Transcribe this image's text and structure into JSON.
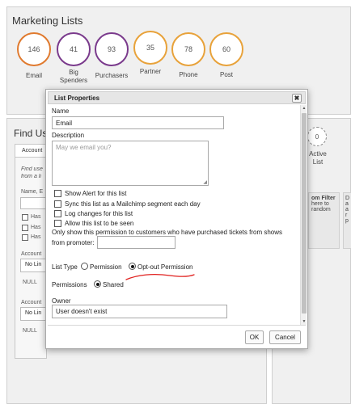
{
  "marketing": {
    "title": "Marketing Lists",
    "lists": [
      {
        "count": "146",
        "label": "Email",
        "color": "#e07a2e"
      },
      {
        "count": "41",
        "label": "Big Spenders",
        "color": "#7a3a8c"
      },
      {
        "count": "93",
        "label": "Purchasers",
        "color": "#7a3a8c"
      },
      {
        "count": "35",
        "label": "Partner",
        "color": "#e8a23a"
      },
      {
        "count": "78",
        "label": "Phone",
        "color": "#e8a23a"
      },
      {
        "count": "60",
        "label": "Post",
        "color": "#e8a23a"
      }
    ]
  },
  "find_users": {
    "title": "Find Us",
    "tab": "Account",
    "hint_line1": "Find use",
    "hint_line2": "from a li",
    "name_label": "Name, E",
    "has_rows": [
      "Has",
      "Has",
      "Has"
    ],
    "account_label_1": "Account",
    "no_limit_1": "No Lin",
    "null_1": "NULL",
    "account_label_2": "Account",
    "no_limit_2": "No Lin",
    "null_2": "NULL"
  },
  "right_panel": {
    "active_count": "0",
    "active_label": "Active List",
    "card_title": "om Filter",
    "card_line1": "here to",
    "card_line2": "random",
    "card2_line1": "D",
    "card2_line2": "a",
    "card2_line3": "a",
    "card2_line4": "r",
    "card2_line5": "p"
  },
  "dialog": {
    "title": "List Properties",
    "close_glyph": "✖",
    "name_label": "Name",
    "name_value": "Email",
    "description_label": "Description",
    "description_placeholder": "May we email you?",
    "checkboxes": [
      {
        "label": "Show Alert for this list",
        "checked": false
      },
      {
        "label": "Sync this list as a Mailchimp segment each day",
        "checked": false
      },
      {
        "label": "Log changes for this list",
        "checked": false
      },
      {
        "label": "Allow this list to be seen",
        "checked": false
      }
    ],
    "promoter_text_line1": "Only show this permission to customers who have purchased tickets from shows",
    "promoter_text_line2": "from promoter:",
    "promoter_value": "",
    "list_type_label": "List Type",
    "list_type_options": [
      {
        "label": "Permission",
        "selected": false
      },
      {
        "label": "Opt-out Permission",
        "selected": true
      }
    ],
    "permissions_label": "Permissions",
    "permissions_option": {
      "label": "Shared",
      "selected": true
    },
    "owner_label": "Owner",
    "owner_value": "User doesn't exist",
    "ok_label": "OK",
    "cancel_label": "Cancel"
  },
  "annotation_color": "#e0201e"
}
